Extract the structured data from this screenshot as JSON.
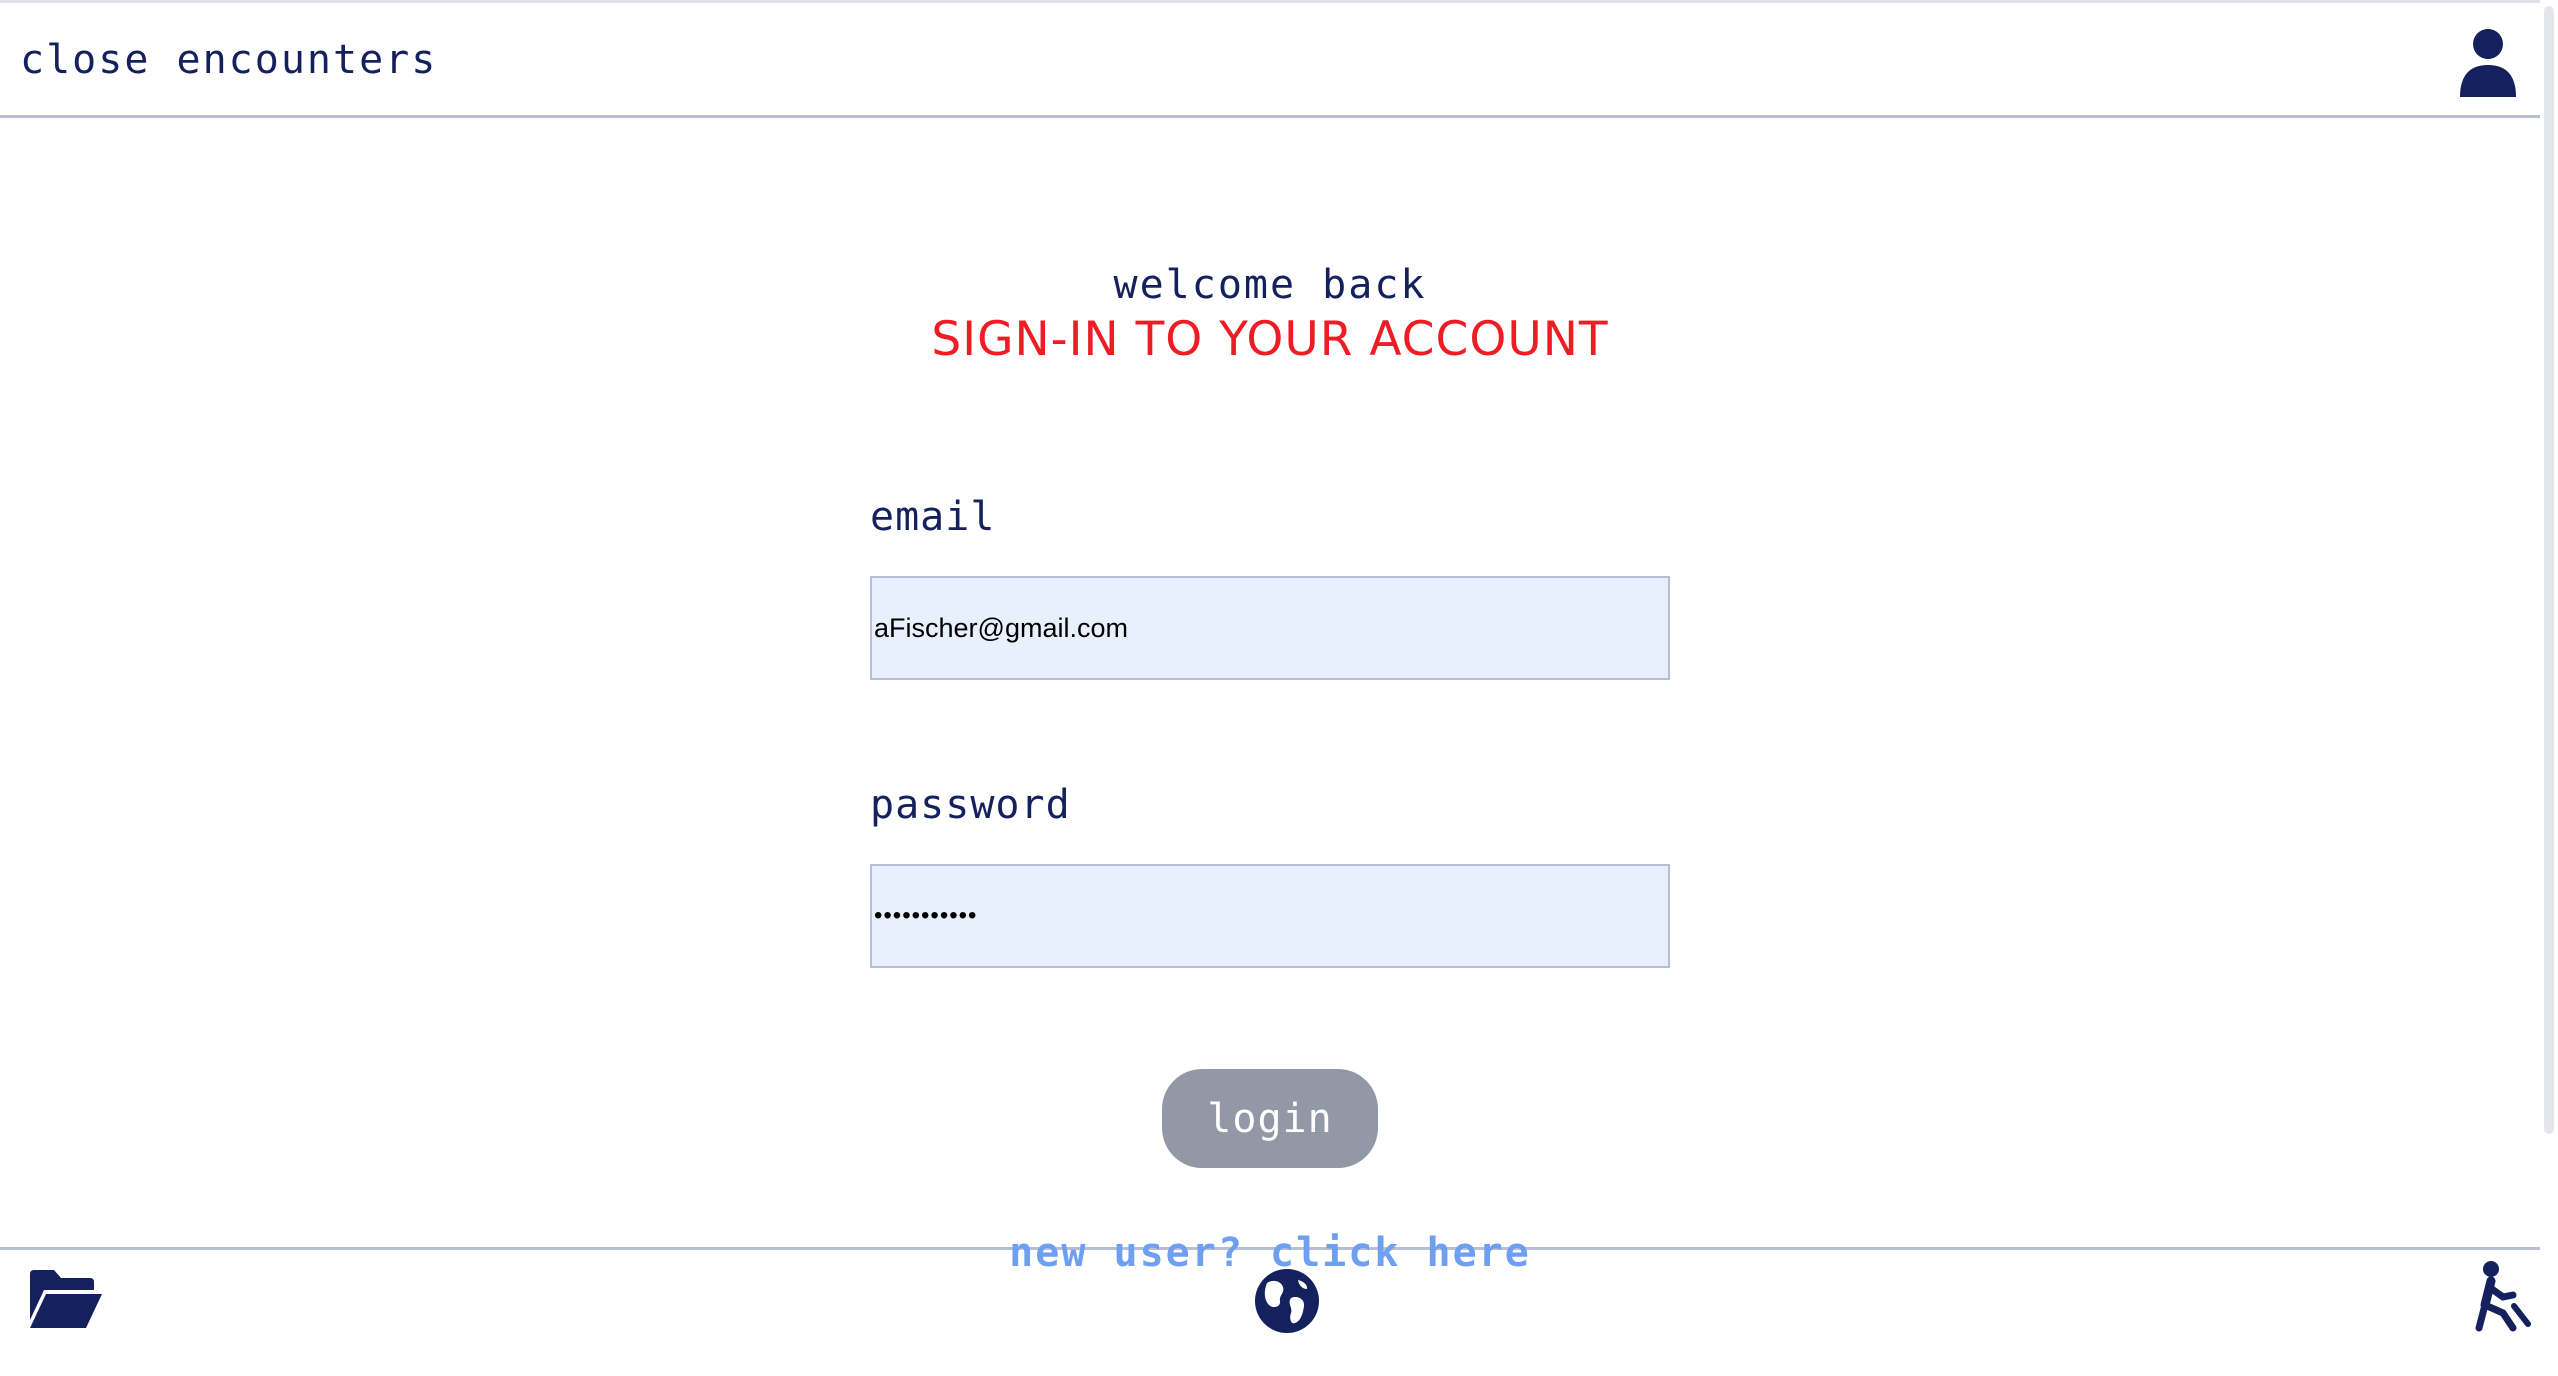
{
  "header": {
    "brand": "close encounters",
    "user_icon": "user-icon"
  },
  "main": {
    "welcome": "welcome back",
    "heading": "SIGN-IN TO YOUR ACCOUNT",
    "email": {
      "label": "email",
      "value": "aFischer@gmail.com"
    },
    "password": {
      "label": "password",
      "value": "•••••••••••"
    },
    "login_label": "login",
    "signup_link": "new user? click here"
  },
  "footer": {
    "icons": [
      "folder-open-icon",
      "globe-icon",
      "running-person-icon"
    ]
  },
  "colors": {
    "navy": "#14215c",
    "accent_red": "#ef1c24",
    "input_bg": "#e8effd",
    "button_gray": "#9298a6",
    "link_blue": "#6f9ff0"
  }
}
